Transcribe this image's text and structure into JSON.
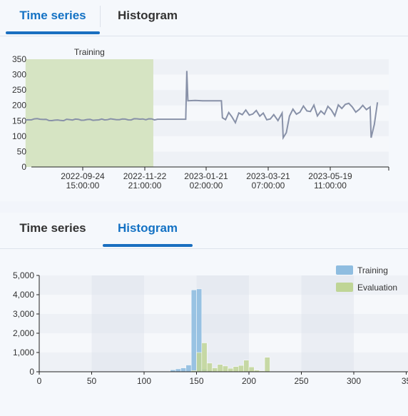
{
  "top_panel": {
    "tabs": [
      {
        "label": "Time series",
        "active": true
      },
      {
        "label": "Histogram",
        "active": false
      }
    ]
  },
  "bottom_panel": {
    "tabs": [
      {
        "label": "Time series",
        "active": false
      },
      {
        "label": "Histogram",
        "active": true
      }
    ]
  },
  "colors": {
    "accent": "#1472c4",
    "line": "#8891a8",
    "training_region": "#d6e4c3",
    "training_bar": "#8fbde0",
    "evaluation_bar": "#bfd596"
  },
  "chart_data": [
    {
      "type": "line",
      "ylim": [
        0,
        350
      ],
      "y_ticks": [
        "0",
        "50",
        "100",
        "150",
        "200",
        "250",
        "300",
        "350"
      ],
      "x_ticks": [
        {
          "line1": "2022-09-24",
          "line2": "15:00:00"
        },
        {
          "line1": "2022-11-22",
          "line2": "21:00:00"
        },
        {
          "line1": "2023-01-21",
          "line2": "02:00:00"
        },
        {
          "line1": "2023-03-21",
          "line2": "07:00:00"
        },
        {
          "line1": "2023-05-19",
          "line2": "11:00:00"
        }
      ],
      "region": {
        "label": "Training",
        "start": "2022-08-01",
        "end": "2022-12-01"
      },
      "series": [
        {
          "x": [
            "2022-08-01",
            "2022-08-15",
            "2022-08-29",
            "2022-09-12",
            "2022-09-26",
            "2022-10-10",
            "2022-10-24",
            "2022-11-07",
            "2022-11-21",
            "2022-12-05",
            "2022-12-19",
            "2023-01-01",
            "2023-01-02",
            "2023-01-03",
            "2023-01-10",
            "2023-01-17",
            "2023-01-24",
            "2023-01-31",
            "2023-02-04",
            "2023-02-05",
            "2023-02-14",
            "2023-02-24",
            "2023-03-06",
            "2023-03-16",
            "2023-03-26",
            "2023-04-03",
            "2023-04-04",
            "2023-04-10",
            "2023-04-20",
            "2023-04-30",
            "2023-05-10",
            "2023-05-20",
            "2023-05-30",
            "2023-06-09",
            "2023-06-19",
            "2023-06-26",
            "2023-06-27",
            "2023-07-03"
          ],
          "y": [
            153,
            155,
            152,
            154,
            152,
            153,
            155,
            153,
            156,
            155,
            155,
            155,
            312,
            215,
            216,
            215,
            215,
            215,
            215,
            160,
            163,
            170,
            172,
            175,
            170,
            175,
            95,
            165,
            178,
            180,
            182,
            185,
            190,
            195,
            200,
            195,
            95,
            210
          ]
        }
      ]
    },
    {
      "type": "bar",
      "xlim": [
        0,
        350
      ],
      "ylim": [
        0,
        5000
      ],
      "x_ticks": [
        "0",
        "50",
        "100",
        "150",
        "200",
        "250",
        "300",
        "35"
      ],
      "y_ticks": [
        "0",
        "1,000",
        "2,000",
        "3,000",
        "4,000",
        "5,000"
      ],
      "legend": {
        "position": "top-right"
      },
      "bin_width": 5,
      "series": [
        {
          "name": "Training",
          "bins": [
            20,
            25,
            125,
            130,
            135,
            140,
            145,
            150,
            155,
            160,
            165
          ],
          "values": [
            10,
            10,
            100,
            150,
            200,
            350,
            4250,
            4300,
            150,
            60,
            20
          ]
        },
        {
          "name": "Evaluation",
          "bins": [
            145,
            150,
            155,
            160,
            165,
            170,
            175,
            180,
            185,
            190,
            195,
            200,
            205,
            210,
            215
          ],
          "values": [
            60,
            1000,
            1500,
            450,
            200,
            380,
            300,
            180,
            270,
            330,
            600,
            250,
            80,
            40,
            750
          ]
        }
      ]
    }
  ]
}
